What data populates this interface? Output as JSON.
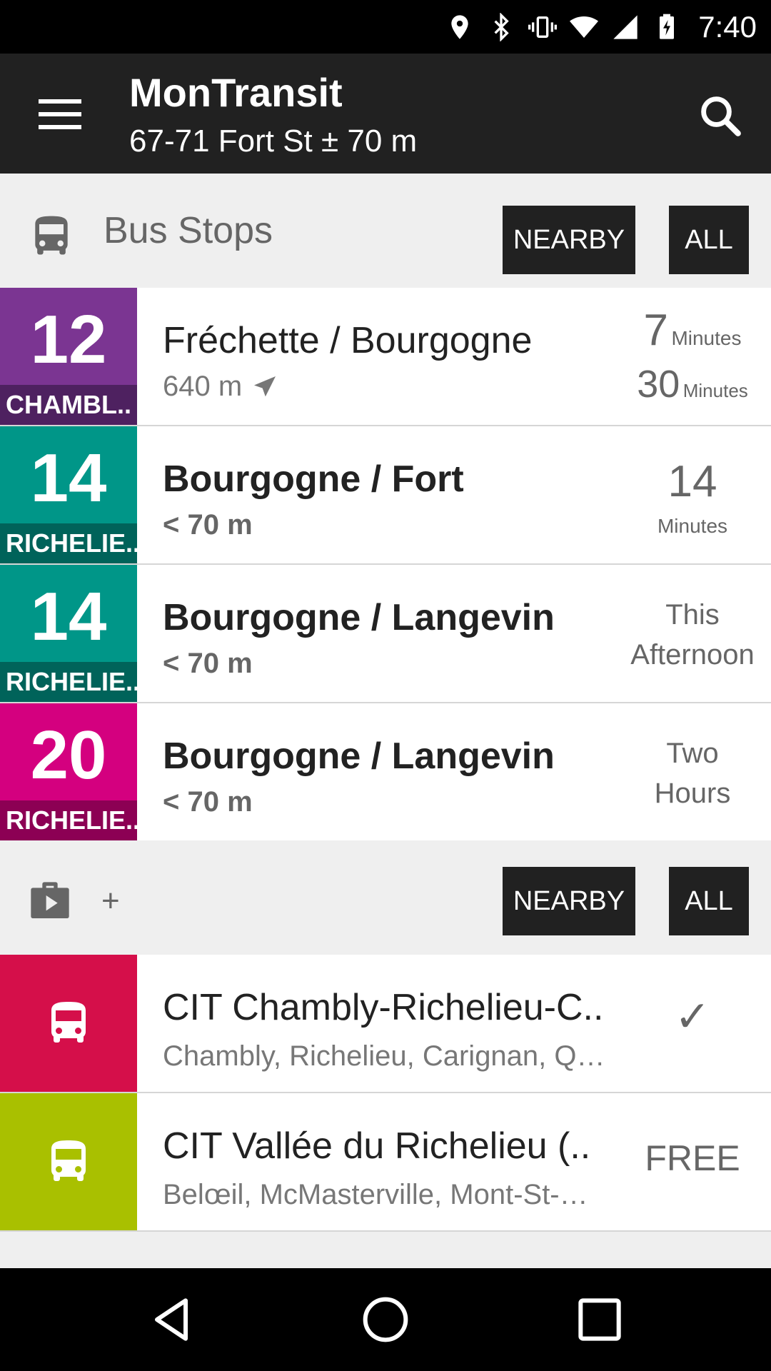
{
  "status_bar": {
    "time": "7:40",
    "icons": [
      "location-icon",
      "bluetooth-icon",
      "vibrate-icon",
      "wifi-icon",
      "signal-icon",
      "battery-charging-icon"
    ]
  },
  "app_bar": {
    "title": "MonTransit",
    "subtitle": "67-71 Fort St ± 70 m"
  },
  "bus_section": {
    "title": "Bus Stops",
    "nearby_label": "NEARBY",
    "all_label": "ALL",
    "stops": [
      {
        "route": "12",
        "direction": "CHAMBL..",
        "color": "#7b3592",
        "dir_color": "#4e2160",
        "name": "Fréchette / Bourgogne",
        "distance": "640 m",
        "time1_value": "7",
        "time1_unit": "Minutes",
        "time2_value": "30",
        "time2_unit": "Minutes"
      },
      {
        "route": "14",
        "direction": "RICHELIE..",
        "color": "#009688",
        "dir_color": "#00635a",
        "name": "Bourgogne / Fort",
        "distance": "< 70 m",
        "time_value": "14",
        "time_unit": "Minutes"
      },
      {
        "route": "14",
        "direction": "RICHELIE..",
        "color": "#009688",
        "dir_color": "#00635a",
        "name": "Bourgogne / Langevin",
        "distance": "< 70 m",
        "time_line1": "This",
        "time_line2": "Afternoon"
      },
      {
        "route": "20",
        "direction": "RICHELIE..",
        "color": "#d4007f",
        "dir_color": "#8c0054",
        "name": "Bourgogne / Langevin",
        "distance": "< 70 m",
        "time_line1": "Two",
        "time_line2": "Hours"
      }
    ]
  },
  "agency_section": {
    "title": "+",
    "nearby_label": "NEARBY",
    "all_label": "ALL",
    "agencies": [
      {
        "name": "CIT Chambly-Richelieu-C..",
        "areas": "Chambly, Richelieu, Carignan, Q…",
        "status": "✓",
        "color": "#d50f4a"
      },
      {
        "name": "CIT Vallée du Richelieu (..",
        "areas": "Belœil, McMasterville, Mont-St-…",
        "status": "FREE",
        "color": "#a9c000"
      }
    ]
  }
}
